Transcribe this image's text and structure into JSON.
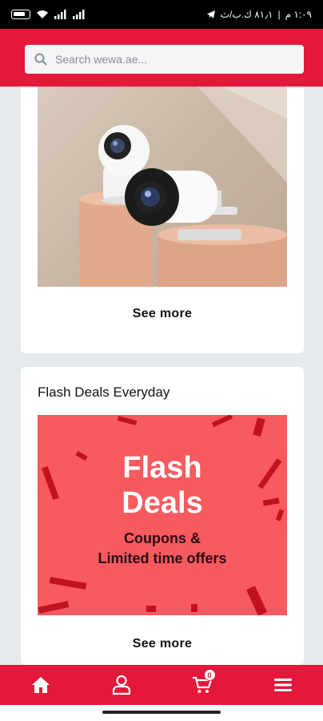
{
  "status_bar": {
    "time": "١:٠٩ م",
    "speed": "٨١٫١ ك.ب/ث",
    "battery_label": "65"
  },
  "search": {
    "placeholder": "Search wewa.ae..."
  },
  "cards": [
    {
      "see_more": "See more"
    },
    {
      "title": "Flash Deals Everyday",
      "banner": {
        "line1": "Flash",
        "line2": "Deals",
        "sub1": "Coupons &",
        "sub2": "Limited time offers"
      },
      "see_more": "See more"
    }
  ],
  "bottom_nav": {
    "cart_count": "0",
    "items": [
      "home-icon",
      "account-icon",
      "cart-icon",
      "menu-icon"
    ]
  },
  "colors": {
    "brand_red": "#e3183a",
    "flash_bg": "#f85a5f"
  }
}
